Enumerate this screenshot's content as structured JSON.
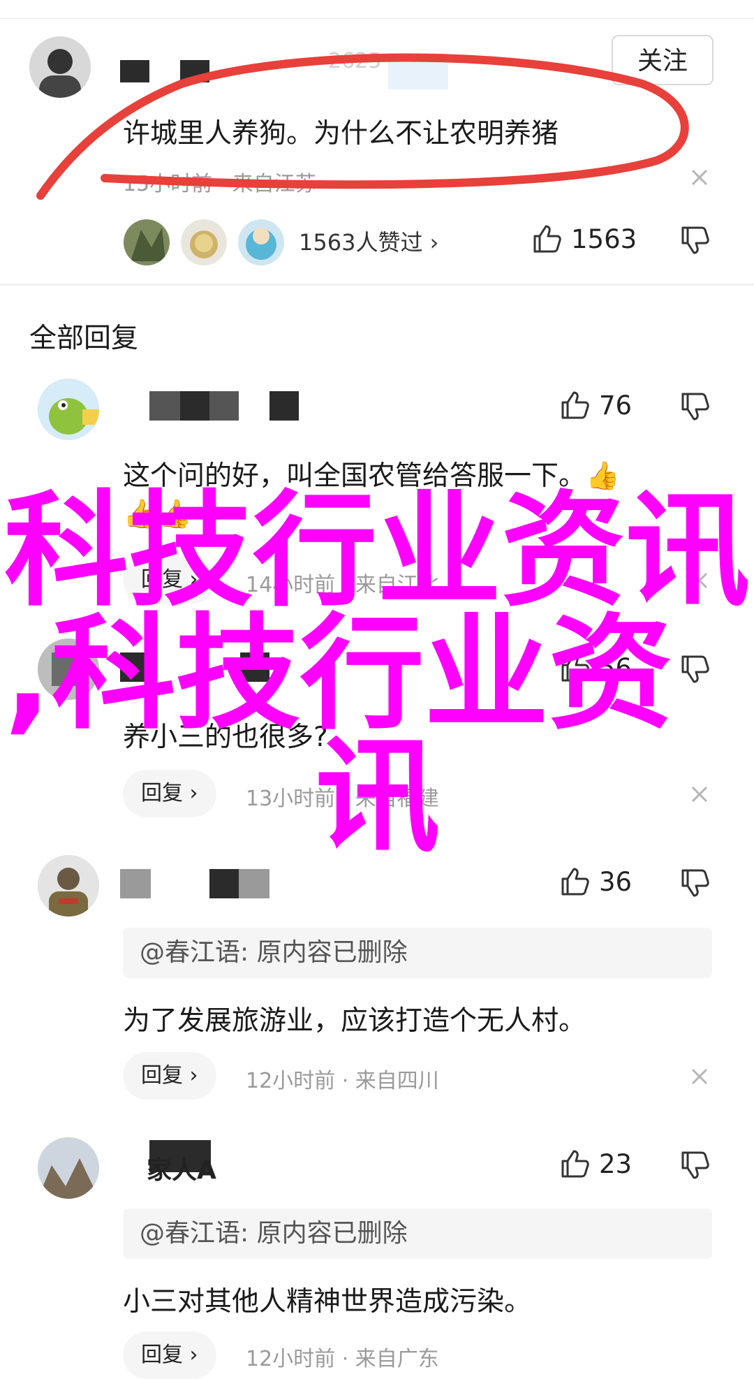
{
  "post": {
    "follow_label": "关注",
    "partial_name": "2625",
    "content": "许城里人养狗。为什么不让农明养猪",
    "meta": "15小时前 · 来自江苏",
    "likers_text": "1563人赞过 ›",
    "like_count": "1563"
  },
  "section_title": "全部回复",
  "replies": [
    {
      "content": "这个问的好，叫全国农管给答服一下。👍",
      "like_count": "76",
      "reply_label": "回复 ›",
      "meta": "14小时前 · 来自江北"
    },
    {
      "content": "养小三的也很多?",
      "like_count": "56",
      "reply_label": "回复 ›",
      "meta": "13小时前 · 来自福建"
    },
    {
      "quote": "@春江语: 原内容已删除",
      "content": "为了发展旅游业，应该打造个无人村。",
      "like_count": "36",
      "reply_label": "回复 ›",
      "meta": "12小时前 · 来自四川"
    },
    {
      "name_suffix": "家人A",
      "quote": "@春江语: 原内容已删除",
      "content": "小三对其他人精神世界造成污染。",
      "like_count": "23",
      "reply_label": "回复 ›",
      "meta": "12小时前 · 来自广东"
    }
  ],
  "watermark": {
    "line1": "科技行业资讯",
    "line2": ",科技行业资",
    "line3": "讯"
  },
  "colors": {
    "watermark": "#ff00ff",
    "annotation_stroke": "#e8403a",
    "meta_text": "#9a9a9a"
  }
}
